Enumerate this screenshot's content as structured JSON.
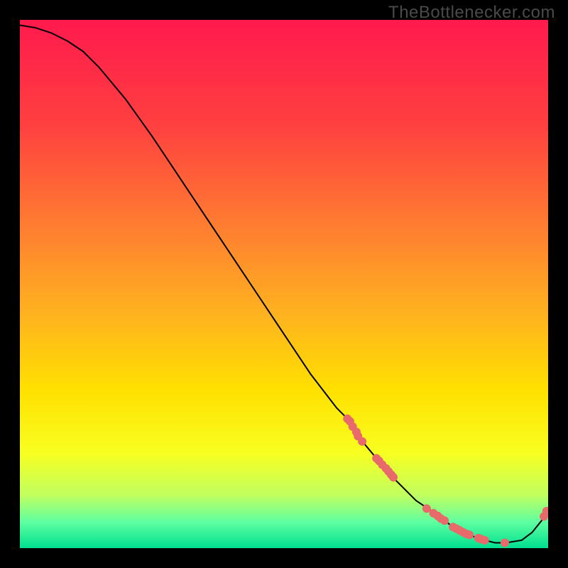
{
  "watermark": "TheBottlenecker.com",
  "chart_data": {
    "type": "line",
    "title": "",
    "xlabel": "",
    "ylabel": "",
    "xlim": [
      0,
      100
    ],
    "ylim": [
      0,
      100
    ],
    "grid": false,
    "legend": false,
    "gradient_stops": [
      {
        "pos": 0.0,
        "color": "#ff1a4d"
      },
      {
        "pos": 0.2,
        "color": "#ff4040"
      },
      {
        "pos": 0.4,
        "color": "#ff8030"
      },
      {
        "pos": 0.55,
        "color": "#ffb020"
      },
      {
        "pos": 0.7,
        "color": "#ffe000"
      },
      {
        "pos": 0.82,
        "color": "#f8ff20"
      },
      {
        "pos": 0.9,
        "color": "#c0ff60"
      },
      {
        "pos": 0.95,
        "color": "#60ffa0"
      },
      {
        "pos": 1.0,
        "color": "#00e090"
      }
    ],
    "series": [
      {
        "name": "curve",
        "color": "#000000",
        "x": [
          0,
          3,
          6,
          9,
          12,
          15,
          20,
          25,
          30,
          35,
          40,
          45,
          50,
          55,
          60,
          62,
          65,
          70,
          75,
          78,
          80,
          82,
          85,
          88,
          90,
          92,
          95,
          97,
          99,
          100
        ],
        "y": [
          99,
          98.5,
          97.5,
          96,
          94,
          91,
          85,
          78,
          70.5,
          63,
          55.5,
          48,
          40.5,
          33,
          26.5,
          24.5,
          20,
          14,
          9,
          7,
          5.5,
          4,
          2.5,
          1.5,
          1,
          1,
          1.5,
          3,
          5.5,
          7
        ]
      }
    ],
    "markers": {
      "name": "points",
      "color": "#e96a6a",
      "radius": 6,
      "x": [
        62,
        62.5,
        63,
        63.7,
        64,
        64.8,
        67.5,
        68,
        68.6,
        69.3,
        69.8,
        70.3,
        70.7,
        77,
        78.3,
        79.1,
        79.7,
        80.4,
        82,
        82.6,
        83.2,
        83.9,
        84.5,
        85.1,
        86.8,
        87.3,
        88,
        91.8,
        99.2,
        99.7
      ],
      "y": [
        24.5,
        24,
        23,
        22,
        21.2,
        20.2,
        17,
        16.5,
        15.8,
        15.1,
        14.5,
        13.9,
        13.4,
        7.5,
        6.6,
        6.1,
        5.6,
        5.2,
        4.0,
        3.7,
        3.4,
        3.0,
        2.7,
        2.5,
        1.9,
        1.7,
        1.5,
        1.0,
        6.0,
        7.0
      ]
    }
  }
}
